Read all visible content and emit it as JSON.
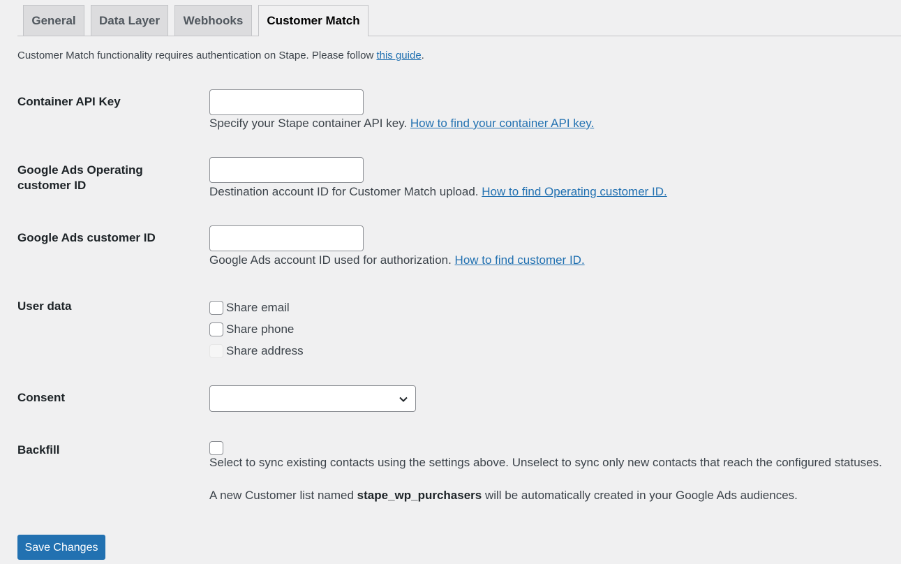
{
  "tabs": [
    {
      "label": "General",
      "active": false
    },
    {
      "label": "Data Layer",
      "active": false
    },
    {
      "label": "Webhooks",
      "active": false
    },
    {
      "label": "Customer Match",
      "active": true
    }
  ],
  "intro": {
    "text": "Customer Match functionality requires authentication on Stape. Please follow ",
    "link": "this guide",
    "suffix": "."
  },
  "fields": {
    "container_api_key": {
      "label": "Container API Key",
      "value": "",
      "description": "Specify your Stape container API key. ",
      "link": "How to find your container API key."
    },
    "operating_customer_id": {
      "label": "Google Ads Operating customer ID",
      "value": "",
      "description": "Destination account ID for Customer Match upload. ",
      "link": "How to find Operating customer ID."
    },
    "customer_id": {
      "label": "Google Ads customer ID",
      "value": "",
      "description": "Google Ads account ID used for authorization. ",
      "link": "How to find customer ID."
    },
    "user_data": {
      "label": "User data",
      "options": [
        {
          "label": "Share email",
          "checked": false,
          "disabled": false
        },
        {
          "label": "Share phone",
          "checked": false,
          "disabled": false
        },
        {
          "label": "Share address",
          "checked": false,
          "disabled": true
        }
      ]
    },
    "consent": {
      "label": "Consent",
      "selected": ""
    },
    "backfill": {
      "label": "Backfill",
      "checked": false,
      "description": "Select to sync existing contacts using the settings above. Unselect to sync only new contacts that reach the configured statuses.",
      "note_prefix": "A new Customer list named ",
      "note_list_name": "stape_wp_purchasers",
      "note_suffix": " will be automatically created in your Google Ads audiences."
    }
  },
  "save_button": "Save Changes",
  "colors": {
    "primary": "#2271b1",
    "background": "#f0f0f1",
    "tab_inactive": "#dcdcde"
  }
}
